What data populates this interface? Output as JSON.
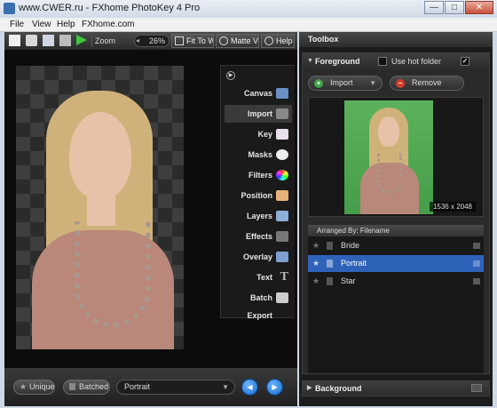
{
  "window": {
    "title": "www.CWER.ru - FXhome PhotoKey 4 Pro",
    "minimize": "—",
    "maximize": "□",
    "close": "✕"
  },
  "menu": [
    "File",
    "View",
    "Help",
    "FXhome.com"
  ],
  "toolbar": {
    "zoom_label": "Zoom",
    "zoom_value": "26%",
    "fit_label": "Fit To Win",
    "matte_label": "Matte Vie",
    "help_label": "Help"
  },
  "side_menu": [
    {
      "label": "Canvas",
      "active": false,
      "icon": "canvas-icon"
    },
    {
      "label": "Import",
      "active": true,
      "icon": "camera-icon"
    },
    {
      "label": "Key",
      "active": false,
      "icon": "eraser-icon"
    },
    {
      "label": "Masks",
      "active": false,
      "icon": "mask-icon"
    },
    {
      "label": "Filters",
      "active": false,
      "icon": "color-wheel-icon"
    },
    {
      "label": "Position",
      "active": false,
      "icon": "position-icon"
    },
    {
      "label": "Layers",
      "active": false,
      "icon": "layers-icon"
    },
    {
      "label": "Effects",
      "active": false,
      "icon": "wand-icon"
    },
    {
      "label": "Overlay",
      "active": false,
      "icon": "overlay-icon"
    },
    {
      "label": "Text",
      "active": false,
      "icon": "text-icon"
    },
    {
      "label": "Batch Export",
      "active": false,
      "icon": "export-icon"
    }
  ],
  "bottom": {
    "unique_label": "Unique",
    "batched_label": "Batched",
    "selected": "Portrait",
    "prev": "◀",
    "next": "▶"
  },
  "toolbox": {
    "title": "Toolbox",
    "foreground": {
      "title": "Foreground",
      "hot_folder_label": "Use hot folder",
      "hot_folder_checked": false,
      "check_right": "✓",
      "import_label": "Import",
      "remove_label": "Remove",
      "dimensions": "1536 x 2048",
      "list_header": "Arranged By: Filename",
      "items": [
        {
          "name": "Bride",
          "selected": false
        },
        {
          "name": "Portrait",
          "selected": true
        },
        {
          "name": "Star",
          "selected": false
        }
      ]
    },
    "background": {
      "title": "Background"
    }
  },
  "colors": {
    "accent": "#2e62b8",
    "preview_bg": "#4fa852",
    "import_icon": "#3fa34a",
    "remove_icon": "#d23b2c"
  }
}
